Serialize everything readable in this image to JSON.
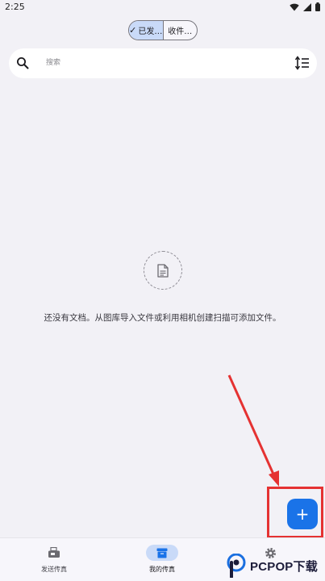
{
  "status_bar": {
    "time": "2:25"
  },
  "segmented": {
    "sent_label": "已发…",
    "received_label": "收件…"
  },
  "search": {
    "placeholder": "搜索"
  },
  "empty_state": {
    "message": "还没有文档。从图库导入文件或利用相机创建扫描可添加文件。"
  },
  "fab": {
    "label": "+"
  },
  "bottom_nav": {
    "items": [
      {
        "label": "发送传真"
      },
      {
        "label": "我的传真"
      }
    ]
  },
  "watermark": {
    "text": "PCPOP下载"
  },
  "colors": {
    "accent": "#1a73e8",
    "highlight": "#e53232",
    "active_pill": "#c9daf8"
  }
}
